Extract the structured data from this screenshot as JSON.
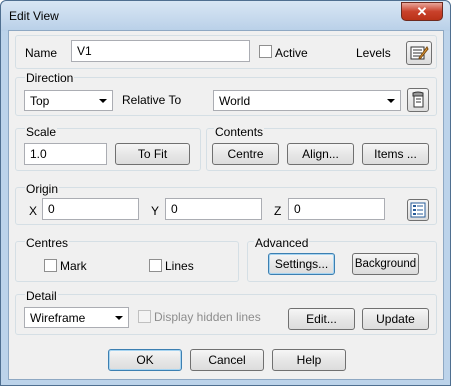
{
  "window": {
    "title": "Edit View",
    "close_glyph": "✕"
  },
  "name_row": {
    "name_label": "Name",
    "name_value": "V1",
    "active_label": "Active",
    "levels_label": "Levels",
    "levels_icon": "levels-edit-icon"
  },
  "direction": {
    "group_label": "Direction",
    "direction_value": "Top",
    "relative_to_label": "Relative To",
    "relative_to_value": "World",
    "workplane_icon": "workplane-selector-icon"
  },
  "scale": {
    "group_label": "Scale",
    "scale_value": "1.0",
    "to_fit_label": "To Fit"
  },
  "contents": {
    "group_label": "Contents",
    "centre_label": "Centre",
    "align_label": "Align...",
    "items_label": "Items ..."
  },
  "origin": {
    "group_label": "Origin",
    "x_label": "X",
    "x_value": "0",
    "y_label": "Y",
    "y_value": "0",
    "z_label": "Z",
    "z_value": "0",
    "list_icon": "coordinate-list-icon"
  },
  "centres": {
    "group_label": "Centres",
    "mark_label": "Mark",
    "lines_label": "Lines"
  },
  "advanced": {
    "group_label": "Advanced",
    "settings_label": "Settings...",
    "background_label": "Background"
  },
  "detail": {
    "group_label": "Detail",
    "mode_value": "Wireframe",
    "hidden_lines_label": "Display hidden lines",
    "edit_label": "Edit...",
    "update_label": "Update"
  },
  "footer": {
    "ok_label": "OK",
    "cancel_label": "Cancel",
    "help_label": "Help"
  },
  "colors": {
    "frame": "#bcd3ea",
    "client": "#f0f0f0",
    "close_button": "#c9412b"
  }
}
